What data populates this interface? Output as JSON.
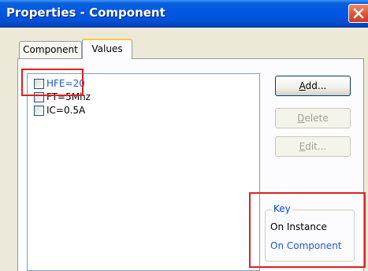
{
  "window": {
    "title": "Properties - Component"
  },
  "tabs": [
    {
      "label": "Component"
    },
    {
      "label": "Values"
    }
  ],
  "values_list": {
    "items": [
      {
        "label": "HFE=20",
        "checked": false,
        "color": "#1a5ad6"
      },
      {
        "label": "FT=5Mhz",
        "checked": false,
        "color": "#000000"
      },
      {
        "label": "IC=0.5A",
        "checked": false,
        "color": "#000000"
      }
    ]
  },
  "buttons": {
    "add": {
      "pre": "",
      "mnemonic": "A",
      "post": "dd..."
    },
    "delete": {
      "pre": "",
      "mnemonic": "D",
      "post": "elete"
    },
    "edit": {
      "pre": "",
      "mnemonic": "E",
      "post": "dit..."
    }
  },
  "key": {
    "legend": "Key",
    "on_instance": "On Instance",
    "on_component": "On Component"
  },
  "colors": {
    "instance": "#000000",
    "component": "#1a5ad6",
    "highlight": "#e02020"
  }
}
